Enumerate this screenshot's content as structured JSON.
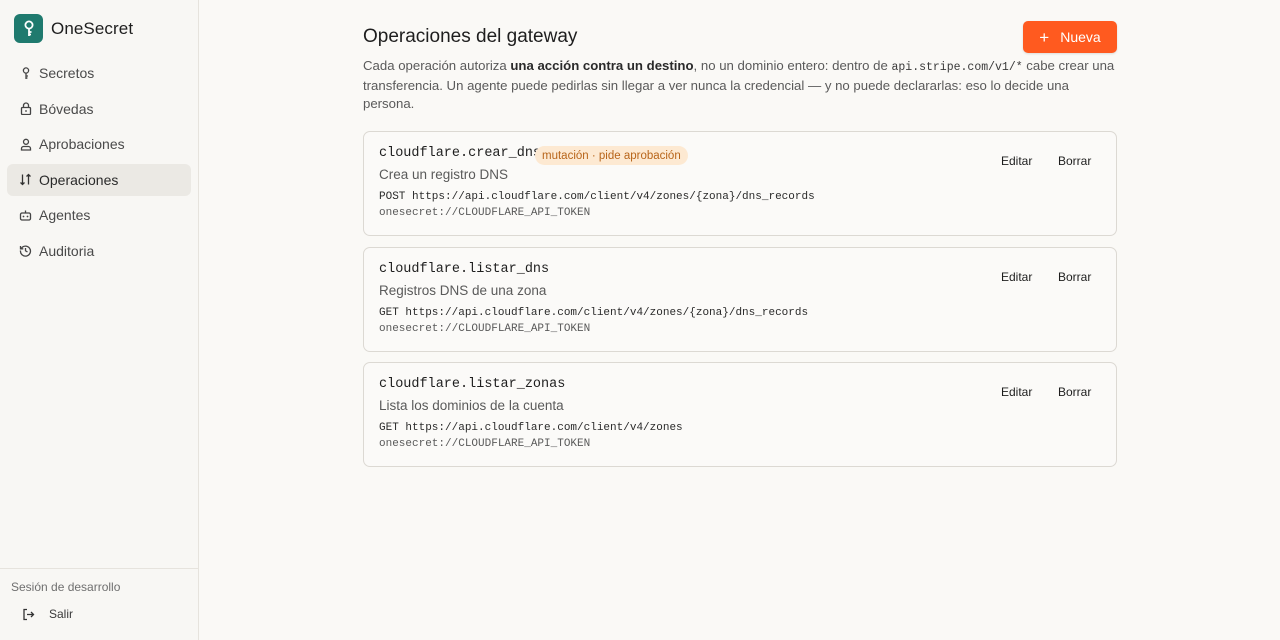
{
  "brand": {
    "name": "OneSecret",
    "color": "#1f7a6e"
  },
  "nav": [
    {
      "label": "Secretos",
      "icon": "key-icon"
    },
    {
      "label": "Bóvedas",
      "icon": "lock-icon"
    },
    {
      "label": "Aprobaciones",
      "icon": "user-icon"
    },
    {
      "label": "Operaciones",
      "icon": "operations-icon",
      "active": true
    },
    {
      "label": "Agentes",
      "icon": "robot-icon"
    },
    {
      "label": "Auditoria",
      "icon": "history-icon"
    }
  ],
  "footer": {
    "session": "Sesión de desarrollo",
    "logout": "Salir"
  },
  "page": {
    "title": "Operaciones del gateway",
    "new_button": "Nueva",
    "accent": "#ff5a1f",
    "description": {
      "part1": "Cada operación autoriza ",
      "bold": "una acción contra un destino",
      "part2": ", no un dominio entero: dentro de ",
      "code": "api.stripe.com/v1/*",
      "part3": " cabe crear una transferencia. Un agente puede pedirlas sin llegar a ver nunca la credencial — y no puede declararlas: eso lo decide una persona."
    }
  },
  "operations": [
    {
      "name": "cloudflare.crear_dns",
      "badge": "mutación · pide aprobación",
      "description": "Crea un registro DNS",
      "endpoint": "POST https://api.cloudflare.com/client/v4/zones/{zona}/dns_records",
      "secret": "onesecret://CLOUDFLARE_API_TOKEN",
      "edit": "Editar",
      "delete": "Borrar"
    },
    {
      "name": "cloudflare.listar_dns",
      "description": "Registros DNS de una zona",
      "endpoint": "GET https://api.cloudflare.com/client/v4/zones/{zona}/dns_records",
      "secret": "onesecret://CLOUDFLARE_API_TOKEN",
      "edit": "Editar",
      "delete": "Borrar"
    },
    {
      "name": "cloudflare.listar_zonas",
      "description": "Lista los dominios de la cuenta",
      "endpoint": "GET https://api.cloudflare.com/client/v4/zones",
      "secret": "onesecret://CLOUDFLARE_API_TOKEN",
      "edit": "Editar",
      "delete": "Borrar"
    }
  ]
}
